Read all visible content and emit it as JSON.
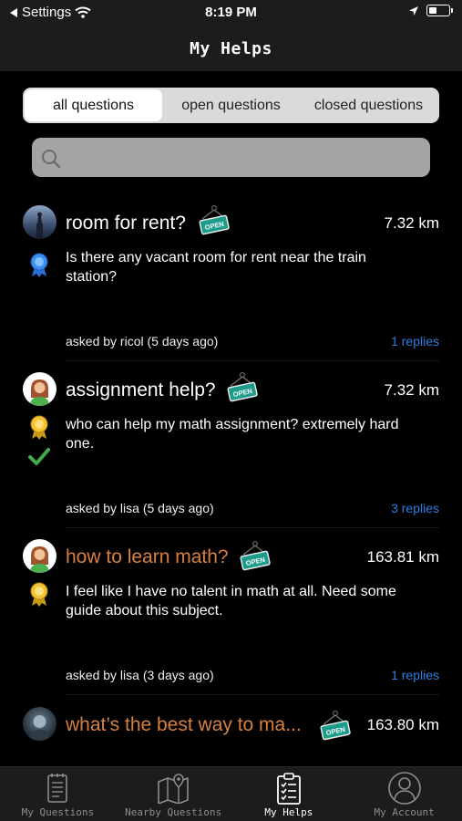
{
  "status_bar": {
    "back_app": "Settings",
    "time": "8:19 PM"
  },
  "nav": {
    "title": "My Helps"
  },
  "segments": {
    "items": [
      "all questions",
      "open questions",
      "closed questions"
    ],
    "selected": "all questions"
  },
  "search": {
    "placeholder": ""
  },
  "questions": [
    {
      "title": "room for rent?",
      "distance": "7.32 km",
      "body": "Is there any vacant room for rent near the train station?",
      "asked": "asked by ricol (5 days ago)",
      "replies": "1 replies",
      "status": "OPEN",
      "badge": "blue-ribbon-icon"
    },
    {
      "title": "assignment help?",
      "distance": "7.32 km",
      "body": "who can help my math assignment? extremely hard one.",
      "asked": "asked by lisa (5 days ago)",
      "replies": "3 replies",
      "status": "OPEN",
      "badge": "gold-ribbon-icon",
      "answered": "check-icon"
    },
    {
      "title": "how to learn math?",
      "distance": "163.81 km",
      "body": "I feel like I have no talent in math at all. Need some guide about this subject.",
      "asked": "asked by lisa (3 days ago)",
      "replies": "1 replies",
      "status": "OPEN",
      "badge": "gold-ribbon-icon"
    },
    {
      "title": "what’s the best way to ma...",
      "distance": "163.80 km",
      "status": "OPEN"
    }
  ],
  "tabs": [
    {
      "label": "My Questions",
      "icon": "notepad-icon"
    },
    {
      "label": "Nearby Questions",
      "icon": "map-icon"
    },
    {
      "label": "My Helps",
      "icon": "clipboard-check-icon"
    },
    {
      "label": "My Account",
      "icon": "user-circle-icon"
    }
  ],
  "colors": {
    "accent_link": "#2d7fe3",
    "title_highlight": "#d8803f",
    "open_sign": "#1c9c8a"
  }
}
